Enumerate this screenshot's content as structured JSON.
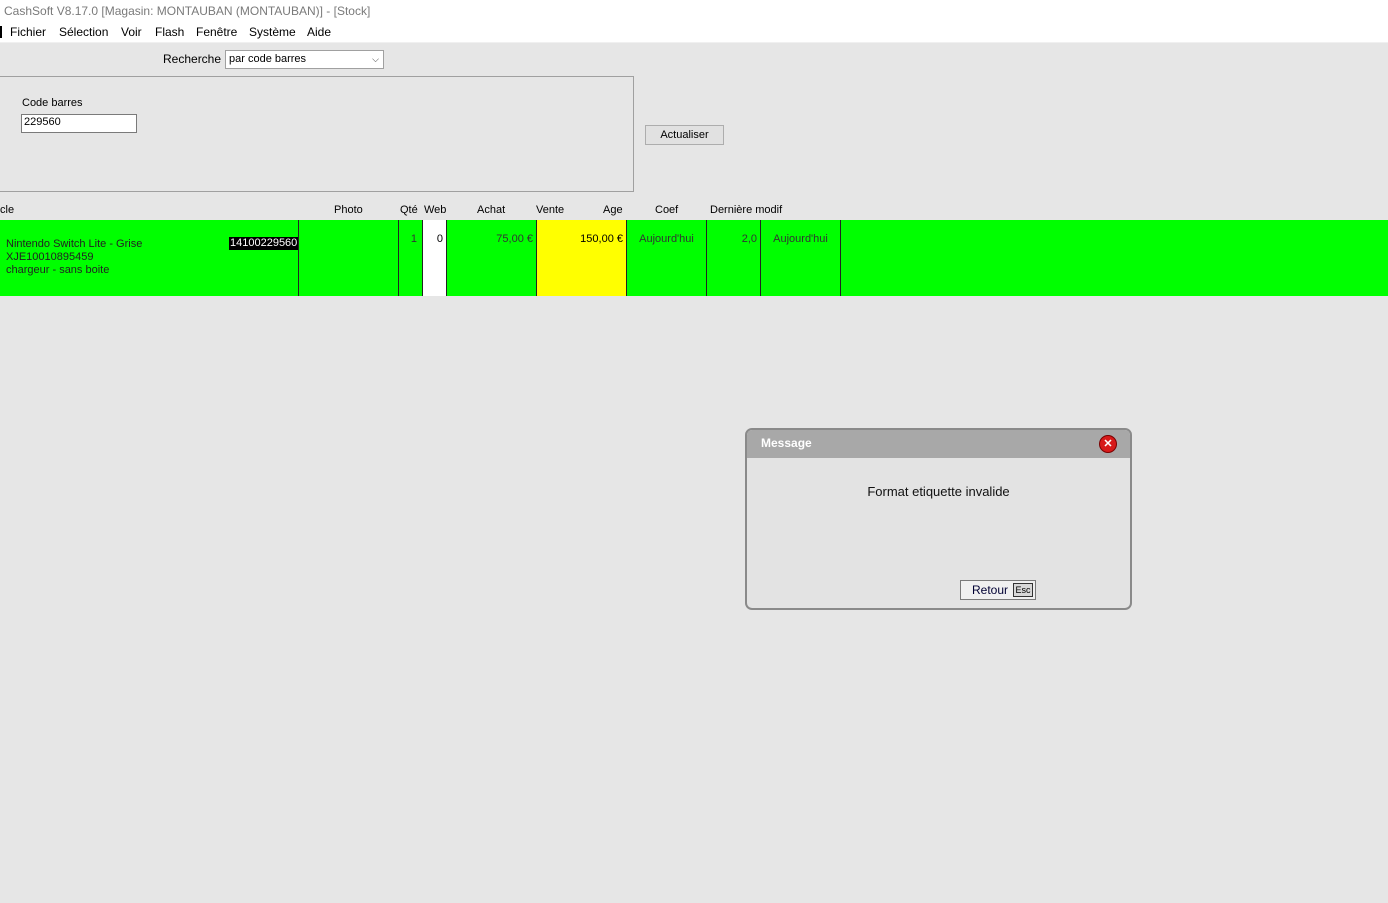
{
  "window": {
    "title": "CashSoft V8.17.0 [Magasin: MONTAUBAN (MONTAUBAN)] - [Stock]"
  },
  "menu": [
    "Fichier",
    "Sélection",
    "Voir",
    "Flash",
    "Fenêtre",
    "Système",
    "Aide"
  ],
  "search": {
    "label": "Recherche",
    "selected": "par code barres"
  },
  "criteria": {
    "barcode_label": "Code barres",
    "barcode_value": "229560"
  },
  "refresh_label": "Actualiser",
  "columns": {
    "article": "cle",
    "photo": "Photo",
    "qty": "Qté",
    "web": "Web",
    "buy": "Achat",
    "sell": "Vente",
    "age": "Age",
    "coef": "Coef",
    "last_modified": "Dernière modif"
  },
  "row": {
    "name": "Nintendo Switch Lite - Grise",
    "serial": "XJE10010895459",
    "note": "chargeur - sans boite",
    "code": "14100229560",
    "qty": "1",
    "web": "0",
    "buy": "75,00 €",
    "sell": "150,00 €",
    "age": "Aujourd'hui",
    "coef": "2,0",
    "last_modified": "Aujourd'hui"
  },
  "dialog": {
    "title": "Message",
    "text": "Format etiquette invalide",
    "button_label": "Retour",
    "shortcut": "Esc"
  },
  "colors": {
    "row_bg": "#00ff00",
    "sell_cell_bg": "#ffff00"
  }
}
